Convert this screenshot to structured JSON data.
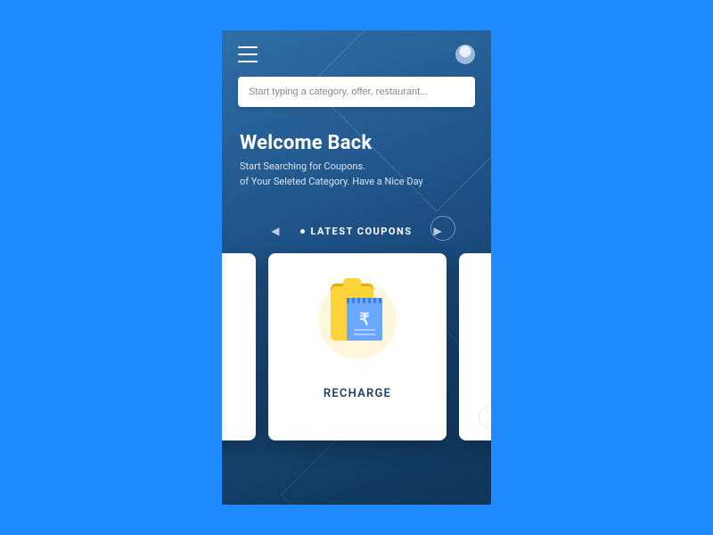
{
  "header": {
    "menu_label": "Menu",
    "avatar_label": "Profile"
  },
  "search": {
    "placeholder": "Start typing a category, offer, restaurant..."
  },
  "welcome": {
    "title": "Welcome Back",
    "line1": "Start Searching for Coupons.",
    "line2": "of Your Seleted Category. Have a Nice Day"
  },
  "coupons": {
    "section_label": "LATEST COUPONS",
    "prev_glyph": "◀",
    "next_glyph": "▶",
    "cards": [
      {
        "title": ""
      },
      {
        "title": "RECHARGE",
        "currency_glyph": "₹"
      },
      {
        "title": ""
      }
    ]
  },
  "colors": {
    "page_bg": "#1f8bff",
    "gradient_top": "#2f6ea5",
    "gradient_bottom": "#0f3558",
    "card_bg": "#ffffff",
    "card_title": "#1b3f66",
    "accent_yellow": "#ffd43b",
    "accent_blue": "#6aa8ff"
  }
}
